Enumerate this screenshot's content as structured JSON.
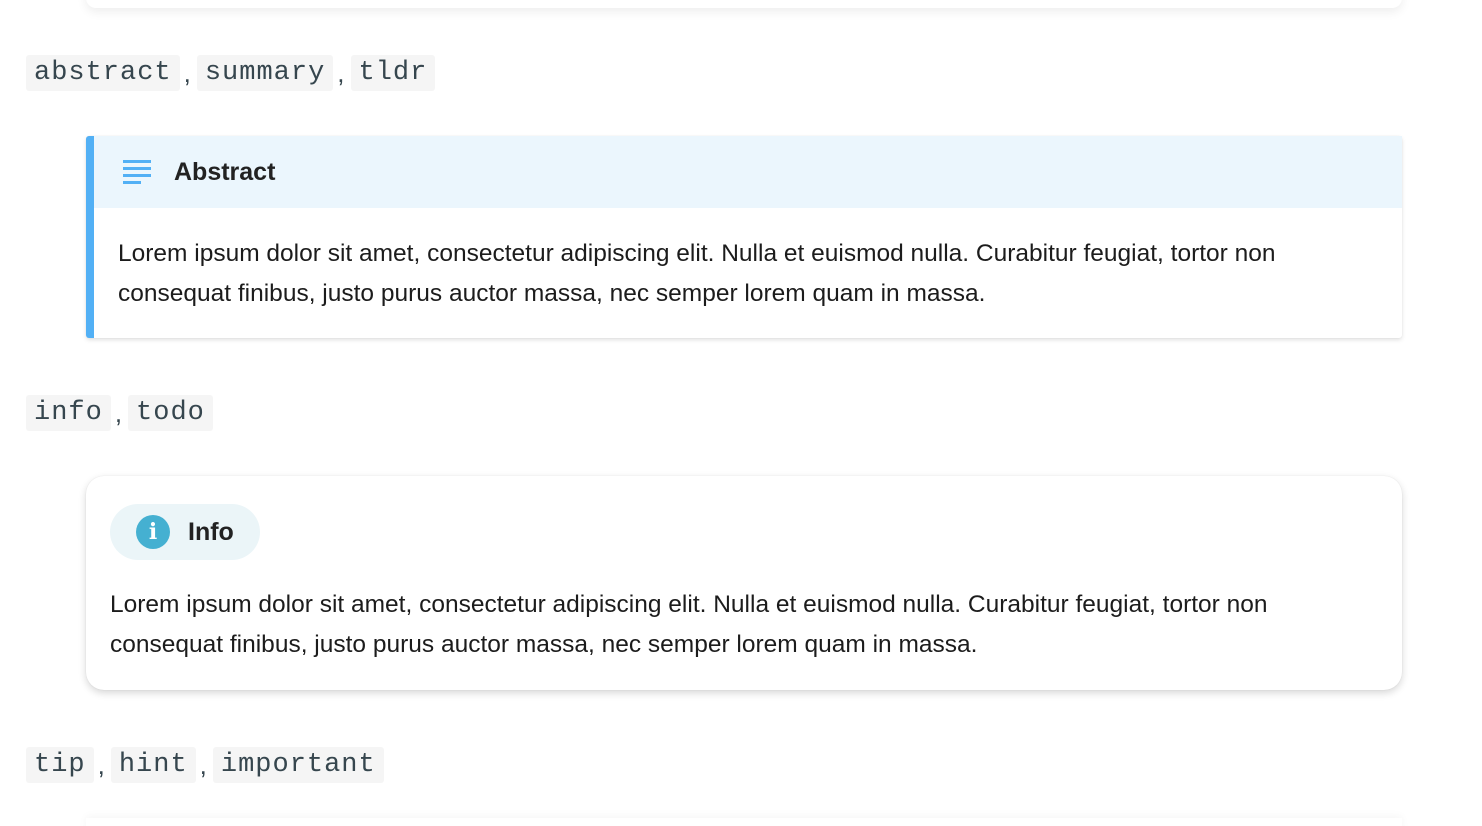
{
  "sections": [
    {
      "tags": [
        "abstract",
        "summary",
        "tldr"
      ],
      "separator": ","
    },
    {
      "tags": [
        "info",
        "todo"
      ],
      "separator": ","
    },
    {
      "tags": [
        "tip",
        "hint",
        "important"
      ],
      "separator": ","
    }
  ],
  "abstract": {
    "title": "Abstract",
    "icon": "list-lines-icon",
    "body": "Lorem ipsum dolor sit amet, consectetur adipiscing elit. Nulla et euismod nulla. Curabitur feugiat, tortor non consequat finibus, justo purus auctor massa, nec semper lorem quam in massa.",
    "accent_color": "#52b0f5",
    "title_bg": "#ebf6fd"
  },
  "info": {
    "title": "Info",
    "icon": "info-circle-icon",
    "icon_glyph": "i",
    "body": "Lorem ipsum dolor sit amet, consectetur adipiscing elit. Nulla et euismod nulla. Curabitur feugiat, tortor non consequat finibus, justo purus auctor massa, nec semper lorem quam in massa.",
    "accent_color": "#45b0d1",
    "pill_bg": "#ebf5f8"
  }
}
